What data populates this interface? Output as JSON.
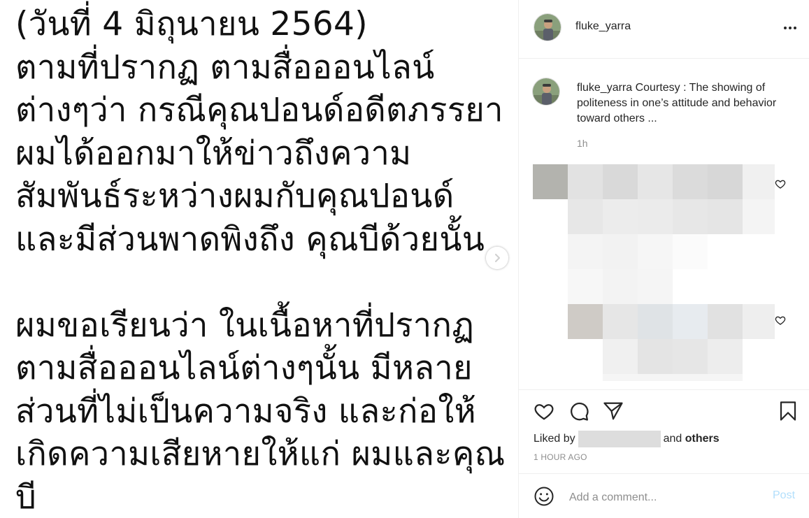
{
  "post_image": {
    "text_lines": [
      "(วันที่ 4 มิถุนายน 2564)",
      "ตามที่ปรากฏ ตามสื่อออนไลน์",
      "ต่างๆว่า กรณีคุณปอนด์อดีตภรรยา",
      "ผมได้ออกมาให้ข่าวถึงความ",
      "สัมพันธ์ระหว่างผมกับคุณปอนด์",
      "และมีส่วนพาดพิงถึง คุณบีด้วยนั้น",
      "",
      "ผมขอเรียนว่า ในเนื้อหาที่ปรากฏ",
      "ตามสื่อออนไลน์ต่างๆนั้น มีหลาย",
      "ส่วนที่ไม่เป็นความจริง และก่อให้",
      "เกิดความเสียหายให้แก่ ผมและคุณ",
      "บี"
    ]
  },
  "header": {
    "username": "fluke_yarra"
  },
  "caption": {
    "username": "fluke_yarra",
    "text": " Courtesy : The showing of politeness in one’s attitude and behavior toward others ...",
    "time": "1h"
  },
  "likes": {
    "prefix": "Liked by",
    "and": "and",
    "others": "others"
  },
  "timestamp": "1 HOUR AGO",
  "comment_box": {
    "placeholder": "Add a comment...",
    "post_label": "Post"
  },
  "colors": {
    "text": "#262626",
    "secondary": "#8e8e8e",
    "post_disabled": "#b2dffc",
    "divider": "#efefef"
  },
  "icons": {
    "more": "more-horizontal-icon",
    "next": "chevron-right-icon",
    "like": "heart-icon",
    "comment": "comment-bubble-icon",
    "share": "paper-plane-icon",
    "save": "bookmark-icon",
    "emoji": "emoji-smile-icon"
  }
}
